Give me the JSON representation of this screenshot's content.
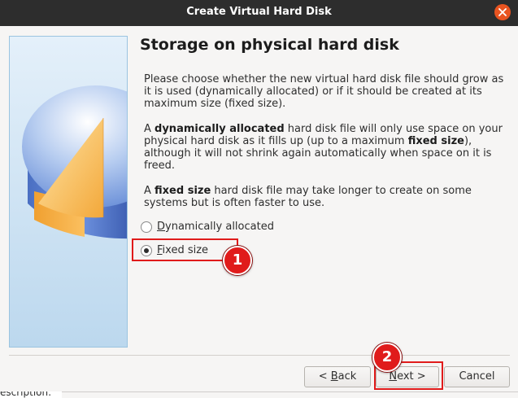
{
  "window": {
    "title": "Create Virtual Hard Disk"
  },
  "page": {
    "heading": "Storage on physical hard disk",
    "paragraph1": "Please choose whether the new virtual hard disk file should grow as it is used (dynamically allocated) or if it should be created at its maximum size (fixed size).",
    "paragraph2": {
      "t1": "A ",
      "b1": "dynamically allocated",
      "t2": " hard disk file will only use space on your physical hard disk as it fills up (up to a maximum ",
      "b2": "fixed size",
      "t3": "), although it will not shrink again automatically when space on it is freed."
    },
    "paragraph3": {
      "t1": "A ",
      "b1": "fixed size",
      "t2": " hard disk file may take longer to create on some systems but is often faster to use."
    }
  },
  "options": [
    {
      "mnemonic": "D",
      "rest": "ynamically allocated",
      "selected": false
    },
    {
      "mnemonic": "F",
      "rest": "ixed size",
      "selected": true
    }
  ],
  "buttons": {
    "back": {
      "prefix": "< ",
      "mnemonic": "B",
      "rest": "ack"
    },
    "next": {
      "mnemonic": "N",
      "rest": "ext >"
    },
    "cancel": "Cancel"
  },
  "annotations": {
    "step1": "1",
    "step2": "2",
    "highlight_color": "#e01b1b"
  },
  "background_fragment": "escription:",
  "colors": {
    "titlebar": "#2d2d2d",
    "close_button": "#e95420",
    "dialog_bg": "#f6f5f4"
  }
}
